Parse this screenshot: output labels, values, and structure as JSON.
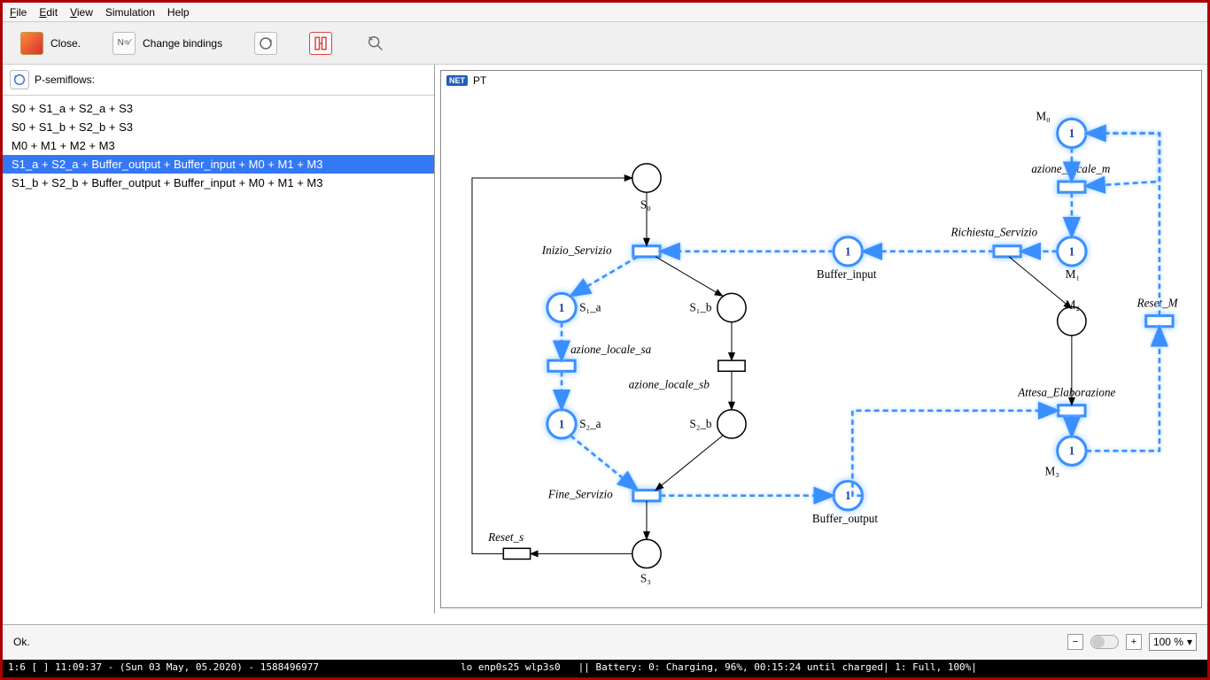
{
  "menu": {
    "file": "File",
    "edit": "Edit",
    "view": "View",
    "sim": "Simulation",
    "help": "Help"
  },
  "toolbar": {
    "close": "Close.",
    "change_bindings": "Change bindings"
  },
  "left": {
    "title": "P-semiflows:",
    "items": [
      "S0 + S1_a + S2_a + S3",
      "S0 + S1_b + S2_b + S3",
      "M0 + M1 + M2 + M3",
      "S1_a + S2_a + Buffer_output + Buffer_input + M0 + M1 + M3",
      "S1_b + S2_b + Buffer_output + Buffer_input + M0 + M1 + M3"
    ],
    "selected": 3
  },
  "canvas": {
    "title": "PT"
  },
  "net": {
    "places": {
      "S0": {
        "label": "S₀",
        "hl": false
      },
      "S1_a": {
        "label": "S₁_a",
        "hl": true,
        "tok": "1"
      },
      "S1_b": {
        "label": "S₁_b",
        "hl": false
      },
      "S2_a": {
        "label": "S₂_a",
        "hl": true,
        "tok": "1"
      },
      "S2_b": {
        "label": "S₂_b",
        "hl": false
      },
      "S3": {
        "label": "S₃",
        "hl": false
      },
      "Buffer_input": {
        "label": "Buffer_input",
        "hl": true,
        "tok": "1"
      },
      "Buffer_output": {
        "label": "Buffer_output",
        "hl": true,
        "tok": "1"
      },
      "M0": {
        "label": "M₀",
        "hl": true,
        "tok": "1"
      },
      "M1": {
        "label": "M₁",
        "hl": true,
        "tok": "1"
      },
      "M2": {
        "label": "M₂",
        "hl": false
      },
      "M3": {
        "label": "M₃",
        "hl": true,
        "tok": "1"
      }
    },
    "transitions": {
      "Inizio_Servizio": {
        "label": "Inizio_Servizio",
        "hl": true
      },
      "azione_locale_sa": {
        "label": "azione_locale_sa",
        "hl": true
      },
      "azione_locale_sb": {
        "label": "azione_locale_sb",
        "hl": false
      },
      "Fine_Servizio": {
        "label": "Fine_Servizio",
        "hl": true
      },
      "Reset_s": {
        "label": "Reset_s",
        "hl": false
      },
      "azione_locale_m": {
        "label": "azione_locale_m",
        "hl": true
      },
      "Richiesta_Servizio": {
        "label": "Richiesta_Servizio",
        "hl": true
      },
      "Attesa_Elaborazione": {
        "label": "Attesa_Elaborazione",
        "hl": true
      },
      "Reset_M": {
        "label": "Reset_M",
        "hl": true
      }
    }
  },
  "status": {
    "text": "Ok."
  },
  "zoom": {
    "value": "100 %"
  },
  "bottombar": {
    "left": "1:6 [ ]    11:09:37 - (Sun 03 May, 05.2020) - 1588496977",
    "center": "lo enp0s25 wlp3s0",
    "right": "||   Battery: 0: Charging, 96%, 00:15:24 until charged| 1: Full, 100%|"
  }
}
